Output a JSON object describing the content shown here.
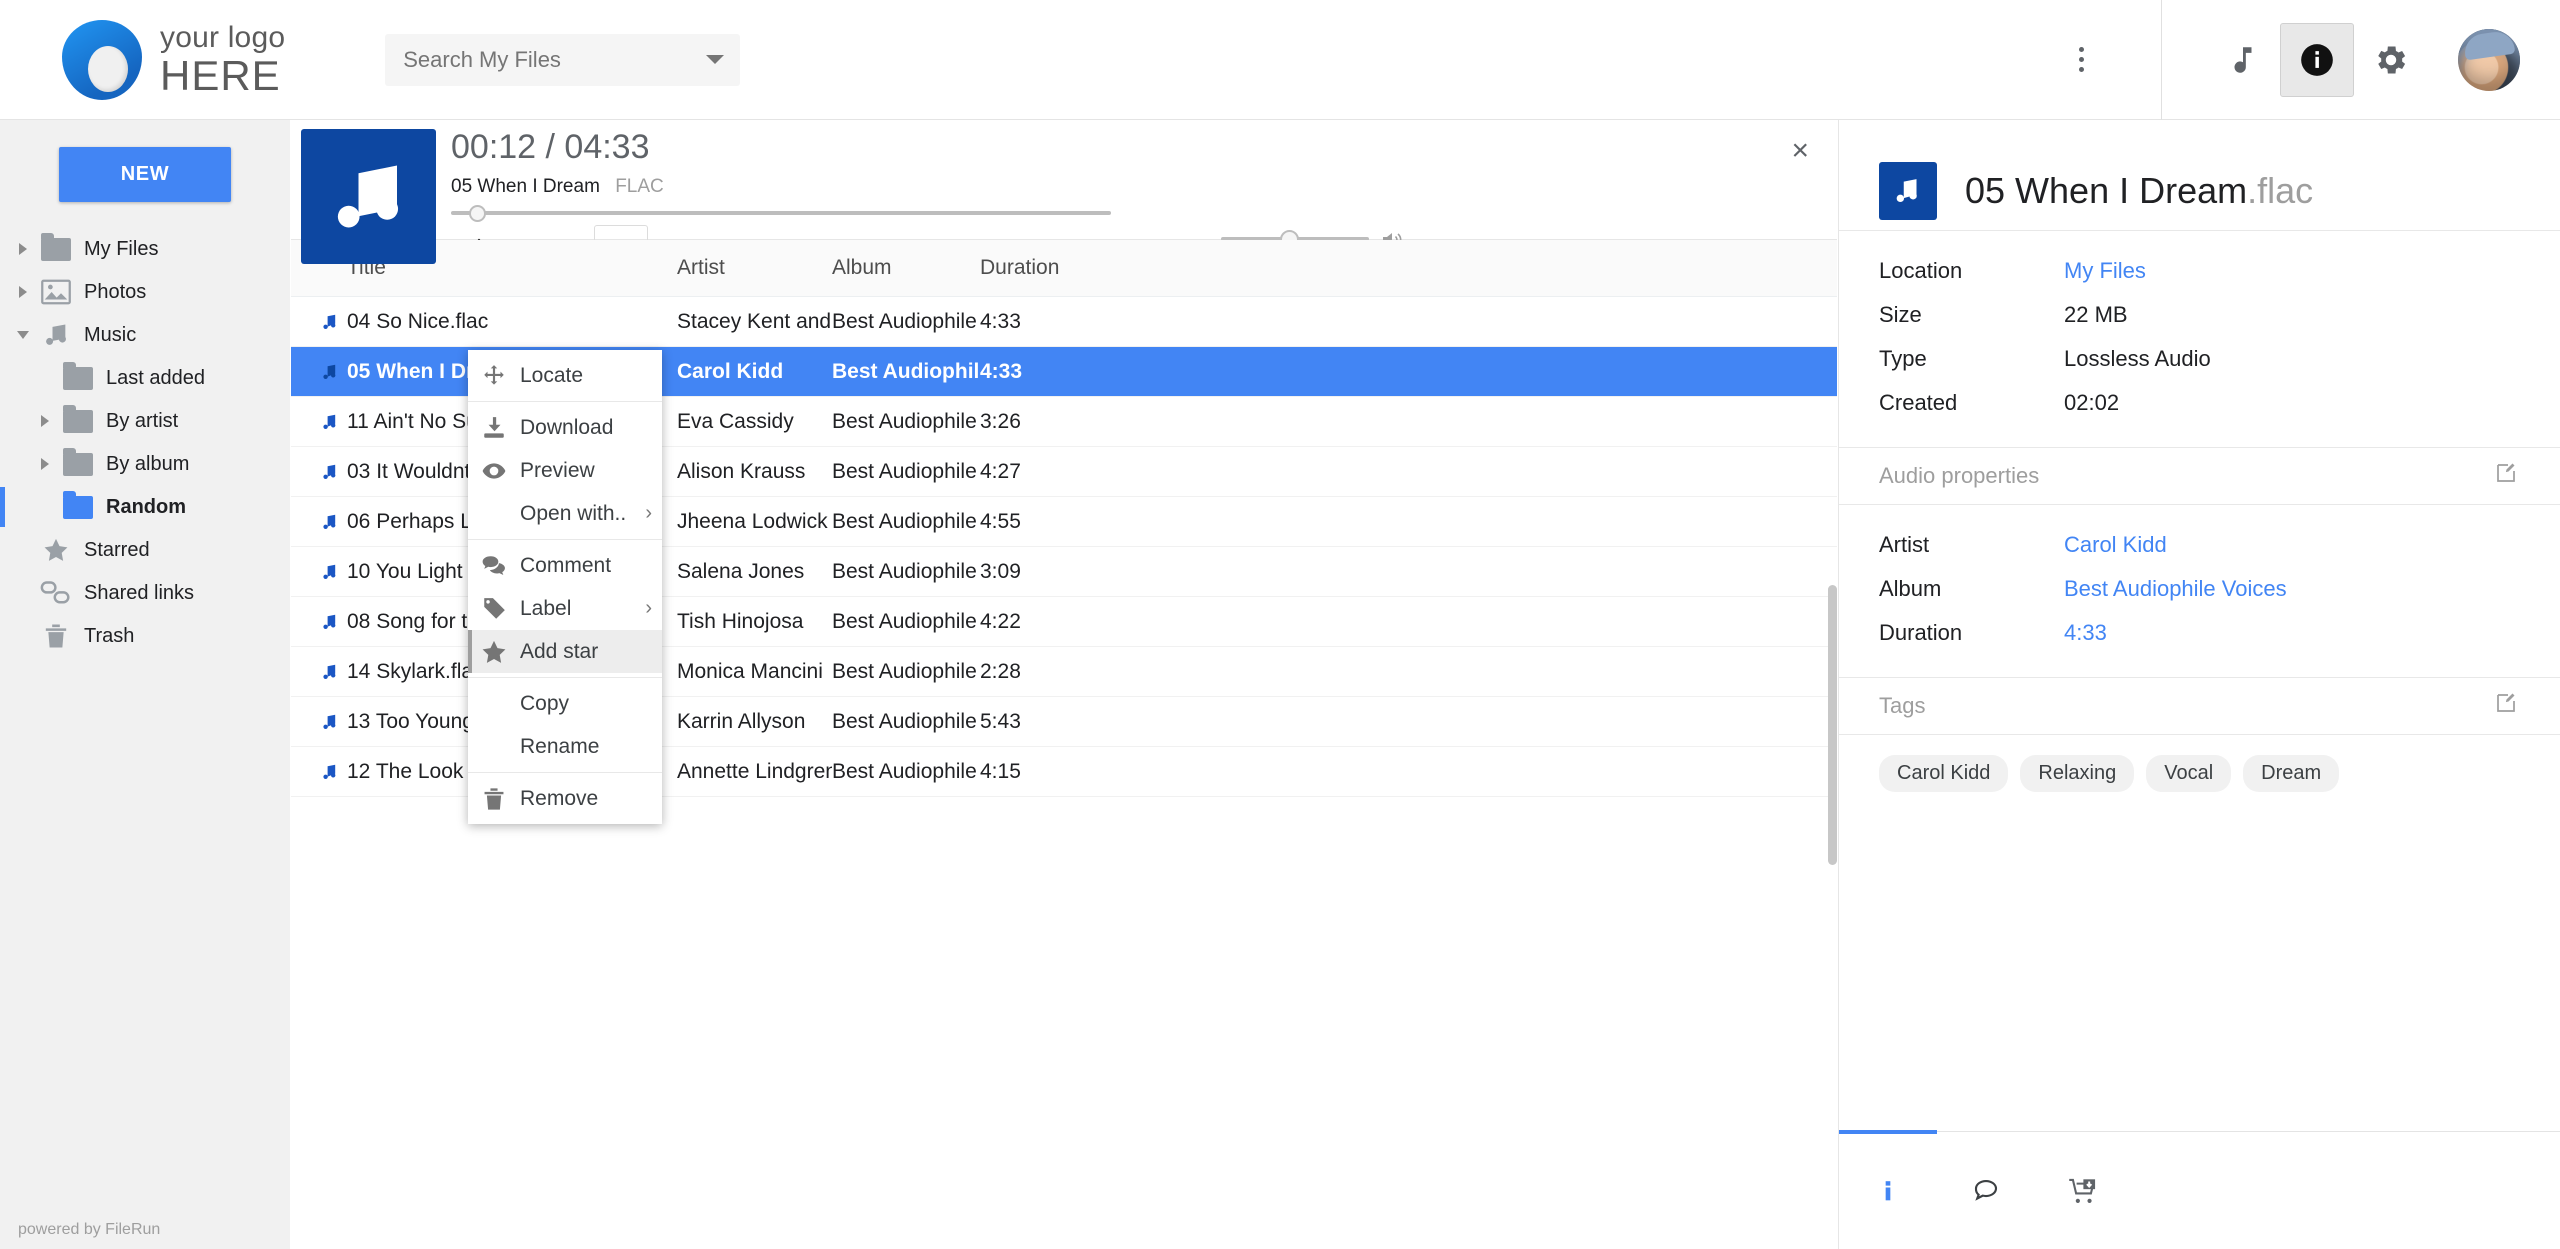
{
  "app": {
    "logo_line1": "your logo",
    "logo_line2": "HERE",
    "powered_by": "powered by FileRun"
  },
  "search": {
    "placeholder": "Search My Files"
  },
  "topbar": {
    "music_icon": "music-note-icon",
    "info_icon": "info-icon",
    "settings_icon": "gear-icon",
    "avatar": "user-avatar",
    "overflow_icon": "kebab-menu-icon"
  },
  "sidebar": {
    "new_button": "NEW",
    "items": [
      {
        "label": "My Files",
        "icon": "folder-icon",
        "indent": 0,
        "arrow": "right",
        "selected": false
      },
      {
        "label": "Photos",
        "icon": "photo-icon",
        "indent": 0,
        "arrow": "right",
        "selected": false
      },
      {
        "label": "Music",
        "icon": "music-note-icon",
        "indent": 0,
        "arrow": "down",
        "selected": false
      },
      {
        "label": "Last added",
        "icon": "folder-icon",
        "indent": 1,
        "arrow": "none",
        "selected": false
      },
      {
        "label": "By artist",
        "icon": "folder-icon",
        "indent": 1,
        "arrow": "right",
        "selected": false
      },
      {
        "label": "By album",
        "icon": "folder-icon",
        "indent": 1,
        "arrow": "right",
        "selected": false
      },
      {
        "label": "Random",
        "icon": "folder-icon-blue",
        "indent": 1,
        "arrow": "none",
        "selected": true
      },
      {
        "label": "Starred",
        "icon": "star-icon",
        "indent": 0,
        "arrow": "none",
        "selected": false
      },
      {
        "label": "Shared links",
        "icon": "link-icon",
        "indent": 0,
        "arrow": "none",
        "selected": false
      },
      {
        "label": "Trash",
        "icon": "trash-icon",
        "indent": 0,
        "arrow": "none",
        "selected": false
      }
    ]
  },
  "player": {
    "time_display": "00:12 / 04:33",
    "track_title": "05 When I Dream",
    "format": "FLAC",
    "seek_percent": 4,
    "volume_percent": 46,
    "close_label": "×",
    "buttons": {
      "shuffle": "shuffle-icon",
      "previous": "previous-track-icon",
      "pause": "pause-icon",
      "next": "next-track-icon",
      "volume": "speaker-icon"
    }
  },
  "table": {
    "columns": [
      "Title",
      "Artist",
      "Album",
      "Duration"
    ],
    "rows": [
      {
        "title": "04 So Nice.flac",
        "artist": "Stacey Kent and...",
        "album": "Best Audiophile ...",
        "duration": "4:33",
        "selected": false
      },
      {
        "title": "05 When I Dream.flac",
        "artist": "Carol Kidd",
        "album": "Best Audiophile ...",
        "duration": "4:33",
        "selected": true
      },
      {
        "title": "11 Ain't No Sunshine.flac",
        "artist": "Eva Cassidy",
        "album": "Best Audiophile ...",
        "duration": "3:26",
        "selected": false
      },
      {
        "title": "03 It Wouldnt Have...",
        "artist": "Alison Krauss",
        "album": "Best Audiophile ...",
        "duration": "4:27",
        "selected": false
      },
      {
        "title": "06 Perhaps Love.flac",
        "artist": "Jheena Lodwick",
        "album": "Best Audiophile ...",
        "duration": "4:55",
        "selected": false
      },
      {
        "title": "10 You Light Up My...",
        "artist": "Salena Jones",
        "album": "Best Audiophile ...",
        "duration": "3:09",
        "selected": false
      },
      {
        "title": "08 Song for the Jet...",
        "artist": "Tish Hinojosa",
        "album": "Best Audiophile ...",
        "duration": "4:22",
        "selected": false
      },
      {
        "title": "14 Skylark.flac",
        "artist": "Monica Mancini",
        "album": "Best Audiophile ...",
        "duration": "2:28",
        "selected": false
      },
      {
        "title": "13 Too Young To Go...",
        "artist": "Karrin Allyson",
        "album": "Best Audiophile ...",
        "duration": "5:43",
        "selected": false
      },
      {
        "title": "12 The Look of Love...",
        "artist": "Annette Lindgren",
        "album": "Best Audiophile ...",
        "duration": "4:15",
        "selected": false
      }
    ]
  },
  "context_menu": {
    "items": [
      {
        "label": "Locate",
        "icon": "move-icon",
        "submenu": false,
        "highlighted": false
      },
      {
        "label": "Download",
        "icon": "download-icon",
        "submenu": false,
        "highlighted": false
      },
      {
        "label": "Preview",
        "icon": "eye-icon",
        "submenu": false,
        "highlighted": false
      },
      {
        "label": "Open with..",
        "icon": "none",
        "submenu": true,
        "highlighted": false
      },
      {
        "label": "Comment",
        "icon": "comment-icon",
        "submenu": false,
        "highlighted": false
      },
      {
        "label": "Label",
        "icon": "tag-icon",
        "submenu": true,
        "highlighted": false
      },
      {
        "label": "Add star",
        "icon": "star-icon",
        "submenu": false,
        "highlighted": true
      },
      {
        "label": "Copy",
        "icon": "none",
        "submenu": false,
        "highlighted": false
      },
      {
        "label": "Rename",
        "icon": "none",
        "submenu": false,
        "highlighted": false
      },
      {
        "label": "Remove",
        "icon": "trash-icon",
        "submenu": false,
        "highlighted": false
      }
    ]
  },
  "details": {
    "file_name": "05 When I Dream",
    "file_ext": ".flac",
    "info": [
      {
        "key": "Location",
        "value": "My Files",
        "link": true
      },
      {
        "key": "Size",
        "value": "22 MB",
        "link": false
      },
      {
        "key": "Type",
        "value": "Lossless Audio",
        "link": false
      },
      {
        "key": "Created",
        "value": "02:02",
        "link": false
      }
    ],
    "audio_section": "Audio properties",
    "audio": [
      {
        "key": "Artist",
        "value": "Carol Kidd",
        "link": true
      },
      {
        "key": "Album",
        "value": "Best Audiophile Voices",
        "link": true
      },
      {
        "key": "Duration",
        "value": "4:33",
        "link": true
      }
    ],
    "tags_section": "Tags",
    "tags": [
      "Carol Kidd",
      "Relaxing",
      "Vocal",
      "Dream"
    ],
    "tabs": [
      {
        "icon": "info-icon",
        "active": true
      },
      {
        "icon": "comment-icon",
        "active": false
      },
      {
        "icon": "cart-download-icon",
        "active": false
      }
    ]
  },
  "colors": {
    "accent": "#4285f4",
    "album_art": "#0d47a1",
    "sidebar_bg": "#f1f1f1"
  }
}
